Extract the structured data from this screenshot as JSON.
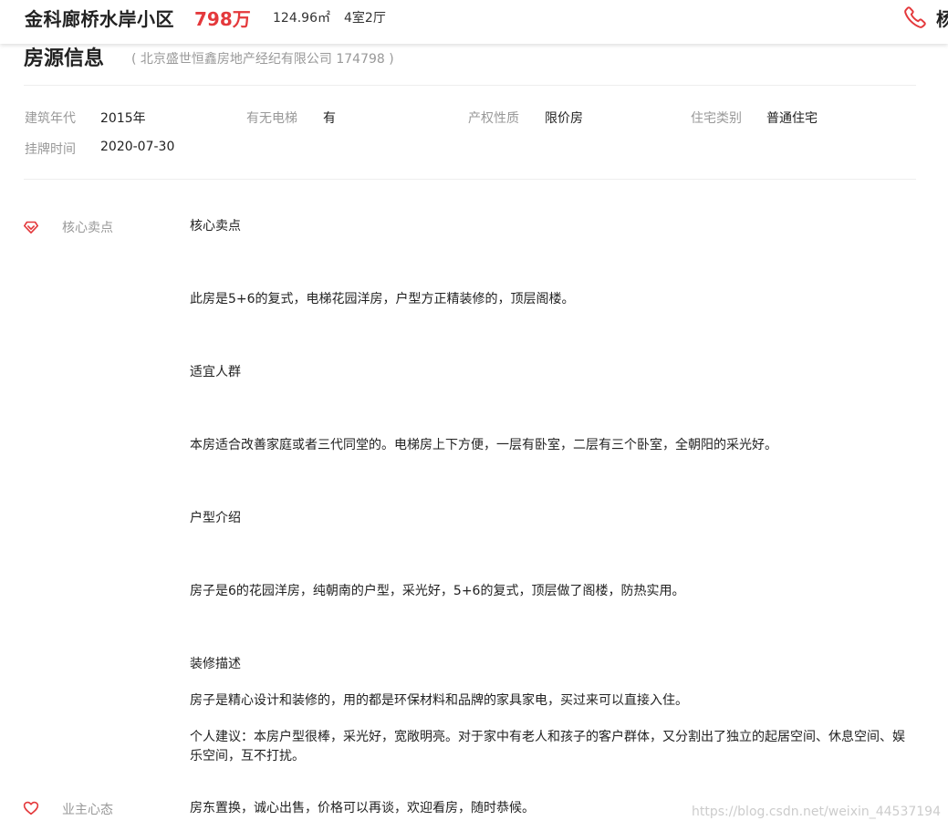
{
  "header": {
    "community_name": "金科廊桥水岸小区",
    "price": "798万",
    "area": "124.96㎡",
    "layout": "4室2厅",
    "phone_text": "杨",
    "phone_icon": "phone-icon"
  },
  "section": {
    "title": "房源信息",
    "agency": "( 北京盛世恒鑫房地产经纪有限公司 174798 )"
  },
  "basic_info": {
    "row1": [
      {
        "label": "建筑年代",
        "value": "2015年"
      },
      {
        "label": "有无电梯",
        "value": "有"
      },
      {
        "label": "产权性质",
        "value": "限价房"
      },
      {
        "label": "住宅类别",
        "value": "普通住宅"
      }
    ],
    "row2": [
      {
        "label": "挂牌时间",
        "value": "2020-07-30"
      }
    ]
  },
  "core_selling": {
    "label": "核心卖点",
    "icon": "diamond-heart-icon",
    "paragraphs": [
      "核心卖点",
      "此房是5+6的复式，电梯花园洋房，户型方正精装修的，顶层阁楼。",
      "适宜人群",
      "本房适合改善家庭或者三代同堂的。电梯房上下方便，一层有卧室，二层有三个卧室，全朝阳的采光好。",
      "户型介绍",
      "房子是6的花园洋房，纯朝南的户型，采光好，5+6的复式，顶层做了阁楼，防热实用。",
      "装修描述",
      "房子是精心设计和装修的，用的都是环保材料和品牌的家具家电，买过来可以直接入住。",
      "个人建议：本房户型很棒，采光好，宽敞明亮。对于家中有老人和孩子的客户群体，又分割出了独立的起居空间、休息空间、娱乐空间，互不打扰。"
    ]
  },
  "owner_mind": {
    "label": "业主心态",
    "icon": "heart-icon",
    "text": "房东置换，诚心出售，价格可以再谈，欢迎看房，随时恭候。"
  },
  "watermark": "https://blog.csdn.net/weixin_44537194",
  "colors": {
    "accent_red": "#e4393c",
    "label_gray": "#999999",
    "text_dark": "#222222"
  }
}
